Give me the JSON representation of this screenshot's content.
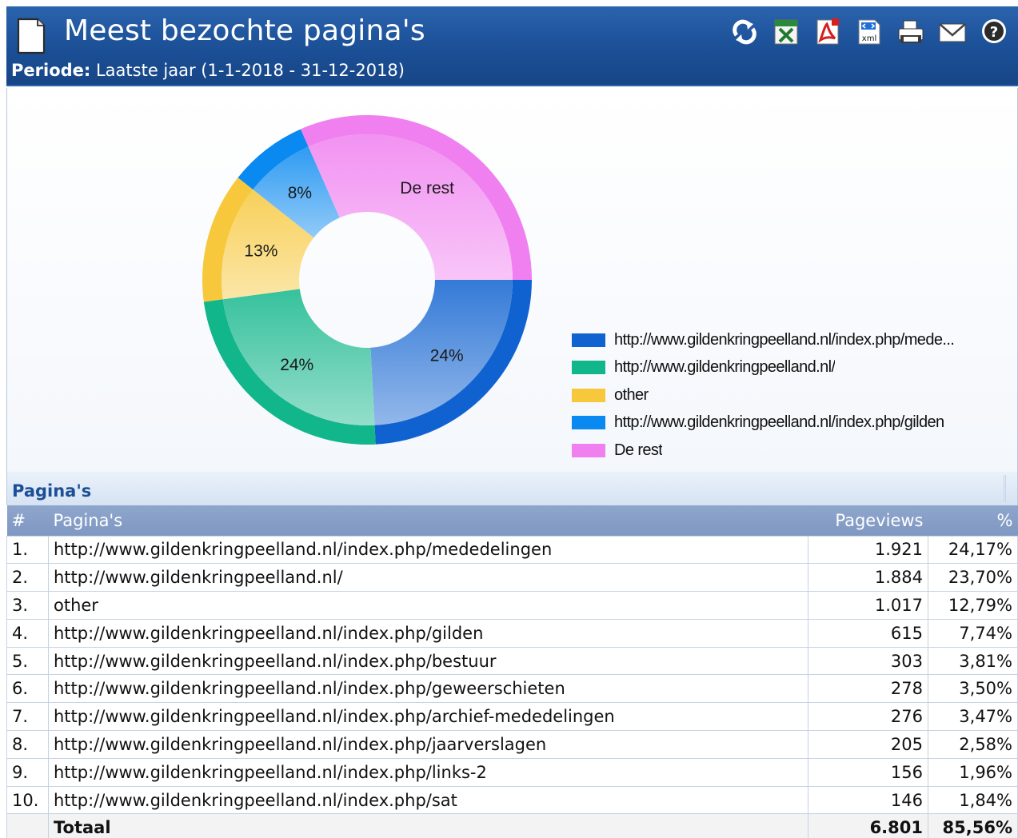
{
  "header": {
    "title": "Meest bezochte pagina's",
    "periode_label": "Periode:",
    "periode_value": "Laatste jaar (1-1-2018 - 31-12-2018)",
    "icons": [
      "refresh-icon",
      "excel-icon",
      "pdf-icon",
      "xml-icon",
      "print-icon",
      "email-icon",
      "help-icon"
    ],
    "xml_icon_text": "xml"
  },
  "colors": {
    "header_bg": "#1b4f96",
    "table_header_bg": "#8aa2ca",
    "section_text": "#1b4f96"
  },
  "chart_data": {
    "type": "pie",
    "donut": true,
    "legend_position": "right",
    "slices": [
      {
        "name": "http://www.gildenkringpeelland.nl/index.php/mede...",
        "label": "24%",
        "value": 24.17,
        "color": "#1062d0"
      },
      {
        "name": "http://www.gildenkringpeelland.nl/",
        "label": "24%",
        "value": 23.7,
        "color": "#12b68b"
      },
      {
        "name": "other",
        "label": "13%",
        "value": 12.79,
        "color": "#f7c83c"
      },
      {
        "name": "http://www.gildenkringpeelland.nl/index.php/gilden",
        "label": "8%",
        "value": 7.74,
        "color": "#0a89f0"
      },
      {
        "name": "De rest",
        "label": "De rest",
        "value": 31.6,
        "color": "#f07ff0"
      }
    ]
  },
  "section": {
    "title": "Pagina's"
  },
  "table": {
    "columns": [
      "#",
      "Pagina's",
      "Pageviews",
      "%"
    ],
    "rows": [
      {
        "idx": "1.",
        "page": "http://www.gildenkringpeelland.nl/index.php/mededelingen",
        "views": "1.921",
        "pct": "24,17%"
      },
      {
        "idx": "2.",
        "page": "http://www.gildenkringpeelland.nl/",
        "views": "1.884",
        "pct": "23,70%"
      },
      {
        "idx": "3.",
        "page": "other",
        "views": "1.017",
        "pct": "12,79%"
      },
      {
        "idx": "4.",
        "page": "http://www.gildenkringpeelland.nl/index.php/gilden",
        "views": "615",
        "pct": "7,74%"
      },
      {
        "idx": "5.",
        "page": "http://www.gildenkringpeelland.nl/index.php/bestuur",
        "views": "303",
        "pct": "3,81%"
      },
      {
        "idx": "6.",
        "page": "http://www.gildenkringpeelland.nl/index.php/geweerschieten",
        "views": "278",
        "pct": "3,50%"
      },
      {
        "idx": "7.",
        "page": "http://www.gildenkringpeelland.nl/index.php/archief-mededelingen",
        "views": "276",
        "pct": "3,47%"
      },
      {
        "idx": "8.",
        "page": "http://www.gildenkringpeelland.nl/index.php/jaarverslagen",
        "views": "205",
        "pct": "2,58%"
      },
      {
        "idx": "9.",
        "page": "http://www.gildenkringpeelland.nl/index.php/links-2",
        "views": "156",
        "pct": "1,96%"
      },
      {
        "idx": "10.",
        "page": "http://www.gildenkringpeelland.nl/index.php/sat",
        "views": "146",
        "pct": "1,84%"
      }
    ],
    "total": {
      "label": "Totaal",
      "views": "6.801",
      "pct": "85,56%"
    }
  }
}
